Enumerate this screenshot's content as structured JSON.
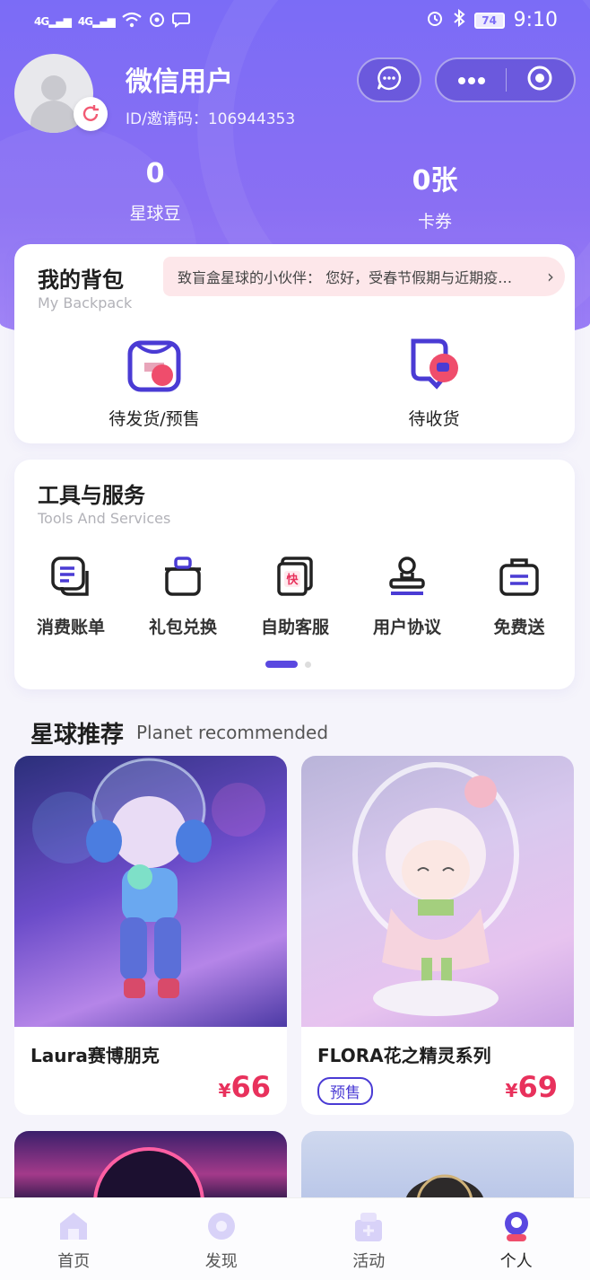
{
  "status_bar": {
    "signal1": "4G",
    "signal2": "4G",
    "battery": "74",
    "time": "9:10"
  },
  "profile": {
    "username": "微信用户",
    "id_label": "ID/邀请码：",
    "id_value": "106944353"
  },
  "stats": {
    "beans_value": "0",
    "beans_label": "星球豆",
    "coupons_value": "0张",
    "coupons_label": "卡券"
  },
  "backpack": {
    "title": "我的背包",
    "subtitle": "My Backpack",
    "notice": "致盲盒星球的小伙伴：  您好，受春节假期与近期疫…",
    "items": [
      {
        "label": "待发货/预售",
        "icon": "package-pending-icon"
      },
      {
        "label": "待收货",
        "icon": "package-receive-icon"
      }
    ]
  },
  "tools": {
    "title": "工具与服务",
    "subtitle": "Tools And Services",
    "items": [
      {
        "label": "消费账单",
        "icon": "bill-icon"
      },
      {
        "label": "礼包兑换",
        "icon": "gift-icon"
      },
      {
        "label": "自助客服",
        "icon": "service-icon"
      },
      {
        "label": "用户协议",
        "icon": "stamp-icon"
      },
      {
        "label": "免费送",
        "icon": "free-bag-icon"
      }
    ],
    "kuai_char": "快"
  },
  "recommend": {
    "title": "星球推荐",
    "subtitle": "Planet recommended",
    "products": [
      {
        "name": "Laura赛博朋克",
        "currency": "¥",
        "price": "66",
        "tag": ""
      },
      {
        "name": "FLORA花之精灵系列",
        "currency": "¥",
        "price": "69",
        "tag": "预售"
      }
    ]
  },
  "tabbar": {
    "items": [
      {
        "label": "首页",
        "icon": "home-icon"
      },
      {
        "label": "发现",
        "icon": "discover-icon"
      },
      {
        "label": "活动",
        "icon": "activity-icon"
      },
      {
        "label": "个人",
        "icon": "profile-icon"
      }
    ],
    "active_index": 3
  },
  "colors": {
    "brand": "#7b6cf6",
    "accent": "#5a48e0",
    "price": "#e8315c",
    "notice_bg": "#fde7ea"
  }
}
